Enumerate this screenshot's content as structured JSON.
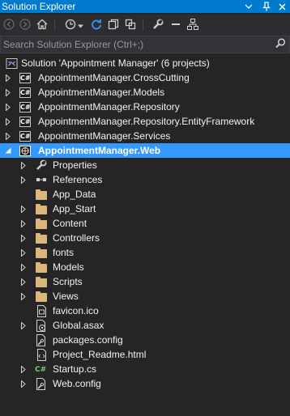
{
  "window": {
    "title": "Solution Explorer"
  },
  "search": {
    "placeholder": "Search Solution Explorer (Ctrl+;)"
  },
  "colors": {
    "accent": "#007acc",
    "selection": "#3399ff",
    "background": "#252526",
    "folder": "#dcb67a"
  },
  "tree": {
    "solution": "Solution 'Appointment Manager' (6 projects)",
    "projects": [
      "AppointmentManager.CrossCutting",
      "AppointmentManager.Models",
      "AppointmentManager.Repository",
      "AppointmentManager.Repository.EntityFramework",
      "AppointmentManager.Services",
      "AppointmentManager.Web"
    ],
    "web_items": [
      "Properties",
      "References",
      "App_Data",
      "App_Start",
      "Content",
      "Controllers",
      "fonts",
      "Models",
      "Scripts",
      "Views",
      "favicon.ico",
      "Global.asax",
      "packages.config",
      "Project_Readme.html",
      "Startup.cs",
      "Web.config"
    ]
  }
}
